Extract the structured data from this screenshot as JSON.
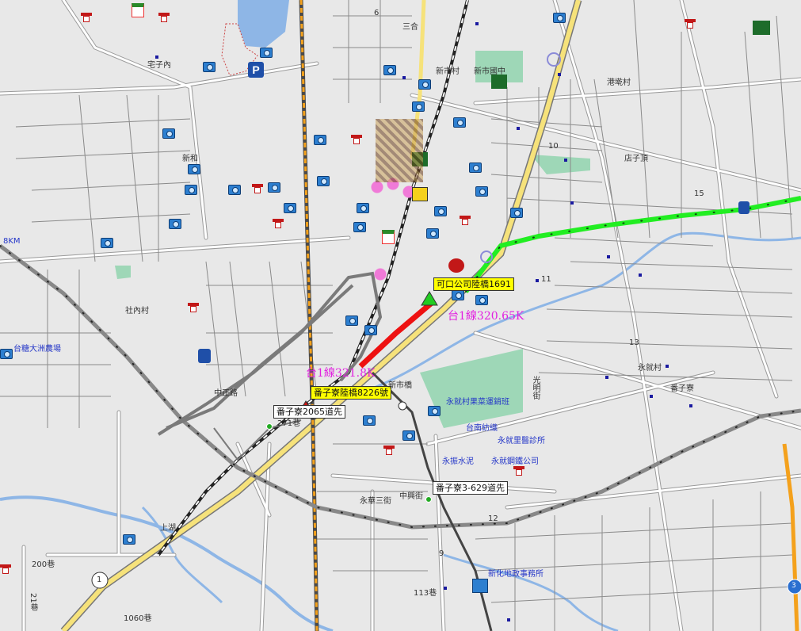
{
  "map": {
    "title": "",
    "colors": {
      "background": "#e8e8e8",
      "road": "#ffffff",
      "road_outline": "#9a9a9a",
      "river": "#8eb6e6",
      "park": "#9ed7b7",
      "highway": "#f6e27a",
      "rail": "#4a4a4a",
      "rail_hsr": "#f4a11c",
      "route_green": "#22ee22",
      "route_red": "#ee1111",
      "route_gray": "#7a7a7a",
      "callout_bg": "#ffff00",
      "km_text": "#e21fe0",
      "poi_blue": "#2d7fd0",
      "temple_red": "#c21818"
    },
    "callouts": {
      "c1": "可口公司陸橋1691",
      "c2": "番子寮陸橋8226號",
      "c3": "番子寮2065道先",
      "c4": "番子寮3-629道先"
    },
    "km_labels": {
      "k1": "台1線320.65K",
      "k2": "台1線321.8K"
    },
    "place_labels": {
      "p_taiwan_sugar": "台糖大洲農場",
      "p_km8": "8KM",
      "p_zhaiziinei": "宅子內",
      "p_sanhe": "三合",
      "p_xinshicun": "新市村",
      "p_xinshiguozhong": "新市國中",
      "p_gangdun": "港墘村",
      "p_dianzi": "店子頂",
      "p_yongjiu": "永就村",
      "p_fanziliao": "番子寮",
      "p_shenei": "社內村",
      "p_yongjiu_fruit": "永就村果菜運銷班",
      "p_tainan_spin": "台南紡織",
      "p_yongjiu_clinic": "永就里醫診所",
      "p_yongjiu_steel": "永就鋼鐵公司",
      "p_yongjiu_cement": "永振水泥",
      "p_xinhua_office": "新化地政事務所",
      "p_xinhua_bridge": "新市橋",
      "p_shanghu": "上湖",
      "p_zhongshan": "中正路",
      "p_guangming": "光明街",
      "p_xinhe": "新和",
      "p_dazhou_lane": "200巷",
      "p_1060": "1060巷",
      "p_271": "271巷",
      "p_21": "21巷",
      "p_113": "113巷",
      "p_yonghua": "永華三街",
      "p_zhongxing": "中興街",
      "p_road1": "1"
    },
    "shields": {
      "s1": "1",
      "s3": "3"
    },
    "grid_numbers": {
      "n6": "6",
      "n10": "10",
      "n11": "11",
      "n13": "13",
      "n15": "15",
      "n9": "9",
      "n12": "12"
    }
  }
}
